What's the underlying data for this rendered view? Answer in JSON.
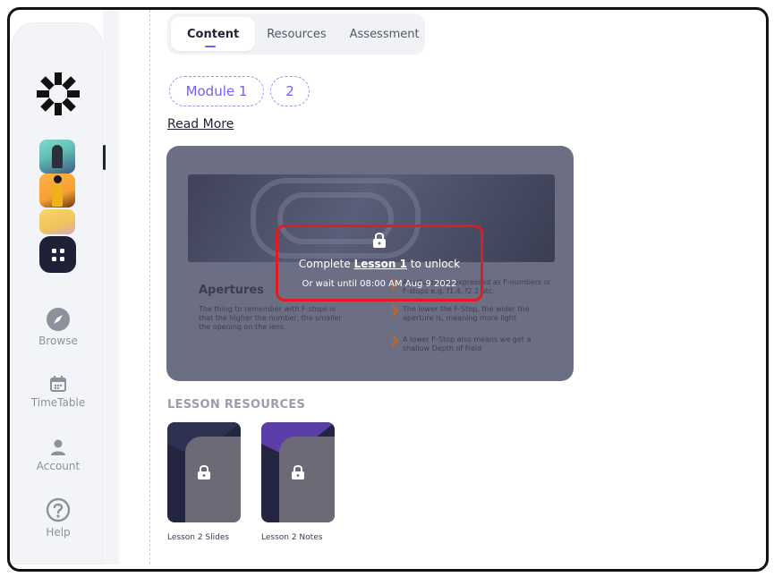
{
  "sidebar": {
    "logo": "kaleido-logo",
    "apps_icon": "grid-icon",
    "nav": [
      {
        "label": "Browse",
        "icon": "compass-icon"
      },
      {
        "label": "TimeTable",
        "icon": "calendar-icon"
      },
      {
        "label": "Account",
        "icon": "user-icon"
      },
      {
        "label": "Help",
        "icon": "question-icon"
      }
    ]
  },
  "tabs": [
    "Content",
    "Resources",
    "Assessment"
  ],
  "modules": [
    "Module 1",
    "2"
  ],
  "read_more": "Read More",
  "lesson": {
    "slide_title": "Apertures",
    "slide_text": "The thing to remember with F-stops is that the higher the number, the smaller the opening on the lens.",
    "bullets": [
      "Apertures are expressed as F-numbers or F-stops e.g. f1.4, f2.2 etc.",
      "The lower the F-Stop, the wider the aperture is, meaning more light",
      "A lower F-Stop also means we get a shallow Depth of Field"
    ],
    "unlock_prefix": "Complete",
    "unlock_link": "Lesson 1",
    "unlock_suffix": "to unlock",
    "wait_text": "Or wait until 08:00 AM Aug 9 2022"
  },
  "resources": {
    "heading": "LESSON RESOURCES",
    "items": [
      {
        "label": "Lesson 2 Slides"
      },
      {
        "label": "Lesson 2 Notes"
      }
    ]
  },
  "colors": {
    "accent": "#7c5cf0",
    "dark": "#1f2237",
    "lock_highlight": "#e01c22"
  }
}
